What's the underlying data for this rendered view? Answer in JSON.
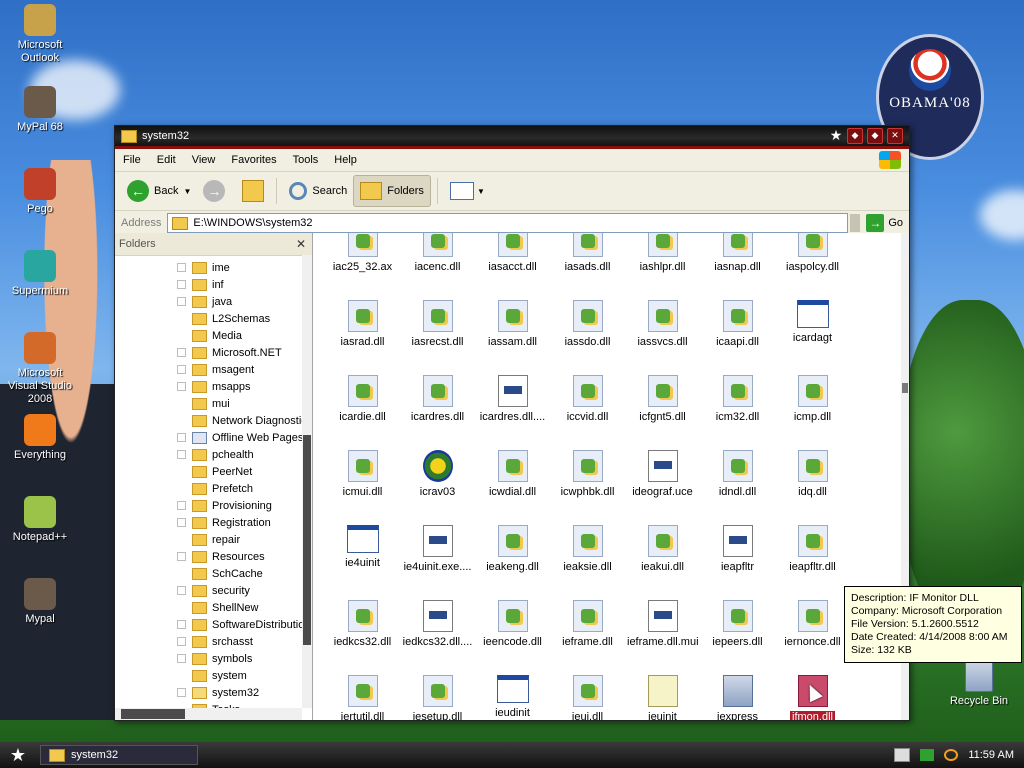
{
  "desktop": {
    "icons": [
      {
        "label": "Microsoft Outlook",
        "icon": "outlook-icon",
        "color": "#c8a24a"
      },
      {
        "label": "MyPal 68",
        "icon": "raccoon-icon",
        "color": "#6b5a4a"
      },
      {
        "label": "Pego",
        "icon": "pego-icon",
        "color": "#c0402a"
      },
      {
        "label": "Supermium",
        "icon": "supermium-icon",
        "color": "#2aa6a0"
      },
      {
        "label": "Microsoft Visual Studio 2008",
        "icon": "visual-studio-icon",
        "color": "#d46a2a"
      },
      {
        "label": "Everything",
        "icon": "everything-icon",
        "color": "#f07a1a"
      },
      {
        "label": "Notepad++",
        "icon": "notepadpp-icon",
        "color": "#9bc34a"
      },
      {
        "label": "Mypal",
        "icon": "raccoon-icon",
        "color": "#6b5a4a"
      }
    ],
    "recycle_bin": "Recycle Bin",
    "badge_text": "OBAMA'08"
  },
  "window": {
    "title": "system32",
    "menu": [
      "File",
      "Edit",
      "View",
      "Favorites",
      "Tools",
      "Help"
    ],
    "toolbar": {
      "back": "Back",
      "search": "Search",
      "folders": "Folders"
    },
    "address_label": "Address",
    "address_value": "E:\\WINDOWS\\system32",
    "go_label": "Go",
    "folders_header": "Folders",
    "tree": [
      {
        "name": "ime",
        "expandable": true
      },
      {
        "name": "inf",
        "expandable": true
      },
      {
        "name": "java",
        "expandable": true
      },
      {
        "name": "L2Schemas",
        "expandable": false
      },
      {
        "name": "Media",
        "expandable": false
      },
      {
        "name": "Microsoft.NET",
        "expandable": true
      },
      {
        "name": "msagent",
        "expandable": true
      },
      {
        "name": "msapps",
        "expandable": true
      },
      {
        "name": "mui",
        "expandable": false
      },
      {
        "name": "Network Diagnostic",
        "expandable": false
      },
      {
        "name": "Offline Web Pages",
        "expandable": true,
        "web": true
      },
      {
        "name": "pchealth",
        "expandable": true
      },
      {
        "name": "PeerNet",
        "expandable": false
      },
      {
        "name": "Prefetch",
        "expandable": false
      },
      {
        "name": "Provisioning",
        "expandable": true
      },
      {
        "name": "Registration",
        "expandable": true
      },
      {
        "name": "repair",
        "expandable": false
      },
      {
        "name": "Resources",
        "expandable": true
      },
      {
        "name": "SchCache",
        "expandable": false
      },
      {
        "name": "security",
        "expandable": true
      },
      {
        "name": "ShellNew",
        "expandable": false
      },
      {
        "name": "SoftwareDistribution",
        "expandable": true
      },
      {
        "name": "srchasst",
        "expandable": true
      },
      {
        "name": "symbols",
        "expandable": true
      },
      {
        "name": "system",
        "expandable": false
      },
      {
        "name": "system32",
        "expandable": true,
        "selected": true
      },
      {
        "name": "Tasks",
        "expandable": false
      }
    ],
    "files": [
      {
        "name": "iac25_32.ax",
        "type": "dll"
      },
      {
        "name": "iacenc.dll",
        "type": "dll"
      },
      {
        "name": "iasacct.dll",
        "type": "dll"
      },
      {
        "name": "iasads.dll",
        "type": "dll"
      },
      {
        "name": "iashlpr.dll",
        "type": "dll"
      },
      {
        "name": "iasnap.dll",
        "type": "dll"
      },
      {
        "name": "iaspolcy.dll",
        "type": "dll"
      },
      {
        "name": "iasrad.dll",
        "type": "dll"
      },
      {
        "name": "iasrecst.dll",
        "type": "dll"
      },
      {
        "name": "iassam.dll",
        "type": "dll"
      },
      {
        "name": "iassdo.dll",
        "type": "dll"
      },
      {
        "name": "iassvcs.dll",
        "type": "dll"
      },
      {
        "name": "icaapi.dll",
        "type": "dll"
      },
      {
        "name": "icardagt",
        "type": "app"
      },
      {
        "name": "icardie.dll",
        "type": "dll"
      },
      {
        "name": "icardres.dll",
        "type": "dll"
      },
      {
        "name": "icardres.dll....",
        "type": "doc"
      },
      {
        "name": "iccvid.dll",
        "type": "dll"
      },
      {
        "name": "icfgnt5.dll",
        "type": "dll"
      },
      {
        "name": "icm32.dll",
        "type": "dll"
      },
      {
        "name": "icmp.dll",
        "type": "dll"
      },
      {
        "name": "icmui.dll",
        "type": "dll"
      },
      {
        "name": "icrav03",
        "type": "globe"
      },
      {
        "name": "icwdial.dll",
        "type": "dll"
      },
      {
        "name": "icwphbk.dll",
        "type": "dll"
      },
      {
        "name": "ideograf.uce",
        "type": "doc"
      },
      {
        "name": "idndl.dll",
        "type": "dll"
      },
      {
        "name": "idq.dll",
        "type": "dll"
      },
      {
        "name": "ie4uinit",
        "type": "app"
      },
      {
        "name": "ie4uinit.exe....",
        "type": "doc"
      },
      {
        "name": "ieakeng.dll",
        "type": "dll"
      },
      {
        "name": "ieaksie.dll",
        "type": "dll"
      },
      {
        "name": "ieakui.dll",
        "type": "dll"
      },
      {
        "name": "ieapfltr",
        "type": "doc"
      },
      {
        "name": "ieapfltr.dll",
        "type": "dll"
      },
      {
        "name": "iedkcs32.dll",
        "type": "dll"
      },
      {
        "name": "iedkcs32.dll....",
        "type": "doc"
      },
      {
        "name": "ieencode.dll",
        "type": "dll"
      },
      {
        "name": "ieframe.dll",
        "type": "dll"
      },
      {
        "name": "ieframe.dll.mui",
        "type": "doc"
      },
      {
        "name": "iepeers.dll",
        "type": "dll"
      },
      {
        "name": "iernonce.dll",
        "type": "dll"
      },
      {
        "name": "iertutil.dll",
        "type": "dll"
      },
      {
        "name": "iesetup.dll",
        "type": "dll"
      },
      {
        "name": "ieudinit",
        "type": "app"
      },
      {
        "name": "ieui.dll",
        "type": "dll"
      },
      {
        "name": "ieuinit",
        "type": "notepad"
      },
      {
        "name": "iexpress",
        "type": "installer"
      },
      {
        "name": "ifmon.dll",
        "type": "selected"
      }
    ],
    "tooltip": {
      "description": "Description: IF Monitor DLL",
      "company": "Company: Microsoft Corporation",
      "version": "File Version: 5.1.2600.5512",
      "created": "Date Created: 4/14/2008 8:00 AM",
      "size": "Size: 132 KB"
    }
  },
  "taskbar": {
    "task": "system32",
    "clock": "11:59 AM"
  },
  "colors": {
    "accent": "#8b0e0e",
    "selection": "#b11a2a"
  }
}
